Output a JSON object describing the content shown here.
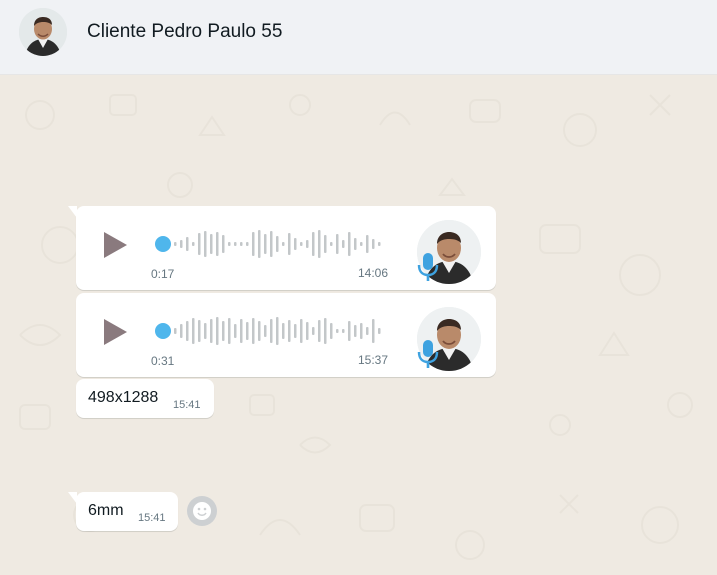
{
  "header": {
    "contact_name": "Cliente Pedro Paulo 55",
    "avatar_icon": "contact-avatar-photo"
  },
  "messages": [
    {
      "type": "voice",
      "duration": "0:17",
      "time": "14:06"
    },
    {
      "type": "voice",
      "duration": "0:31",
      "time": "15:37"
    },
    {
      "type": "text",
      "text": "498x1288",
      "time": "15:41"
    },
    {
      "type": "text",
      "text": "6mm",
      "time": "15:41"
    }
  ],
  "icons": {
    "play": "play-icon",
    "mic": "microphone-icon",
    "reaction": "emoji-reaction-icon"
  },
  "colors": {
    "chat_background": "#efeae2",
    "header_background": "#f0f2f5",
    "bubble": "#ffffff",
    "playhead": "#4fb6ec",
    "mic": "#3ea2e0",
    "play_button": "#8a7a7e"
  }
}
